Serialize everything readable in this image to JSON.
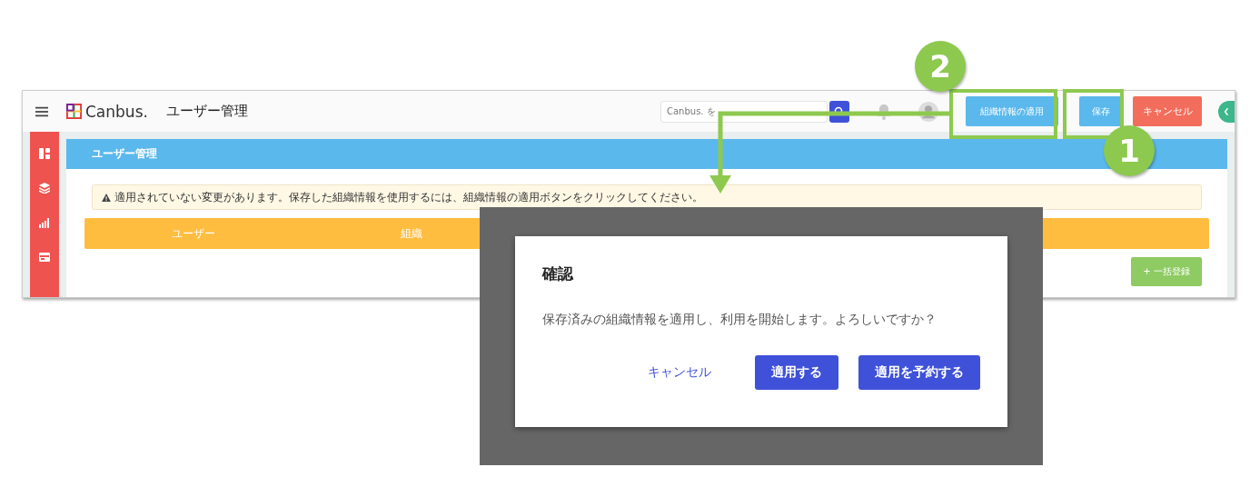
{
  "app": {
    "logo": "Canbus.",
    "page_title": "ユーザー管理",
    "search": {
      "placeholder": "Canbus. を"
    },
    "buttons": [
      {
        "label": "組織情報の適用",
        "kind": "apply"
      },
      {
        "label": "保存",
        "kind": "save"
      },
      {
        "label": "キャンセル",
        "kind": "cancel"
      }
    ]
  },
  "panel": {
    "title": "ユーザー管理",
    "warning": "適用されていない変更があります。保存した組織情報を使用するには、組織情報の適用ボタンをクリックしてください。",
    "table": {
      "columns": [
        "ユーザー",
        "組織"
      ]
    },
    "bulk_button": "+ 一括登録"
  },
  "dialog": {
    "title": "確認",
    "message": "保存済みの組織情報を適用し、利用を開始します。よろしいですか？",
    "buttons": [
      {
        "label": "キャンセル",
        "kind": "text"
      },
      {
        "label": "適用する",
        "kind": "primary"
      },
      {
        "label": "適用を予約する",
        "kind": "primary"
      }
    ]
  },
  "callouts": [
    {
      "number": "2"
    },
    {
      "number": "1"
    }
  ]
}
